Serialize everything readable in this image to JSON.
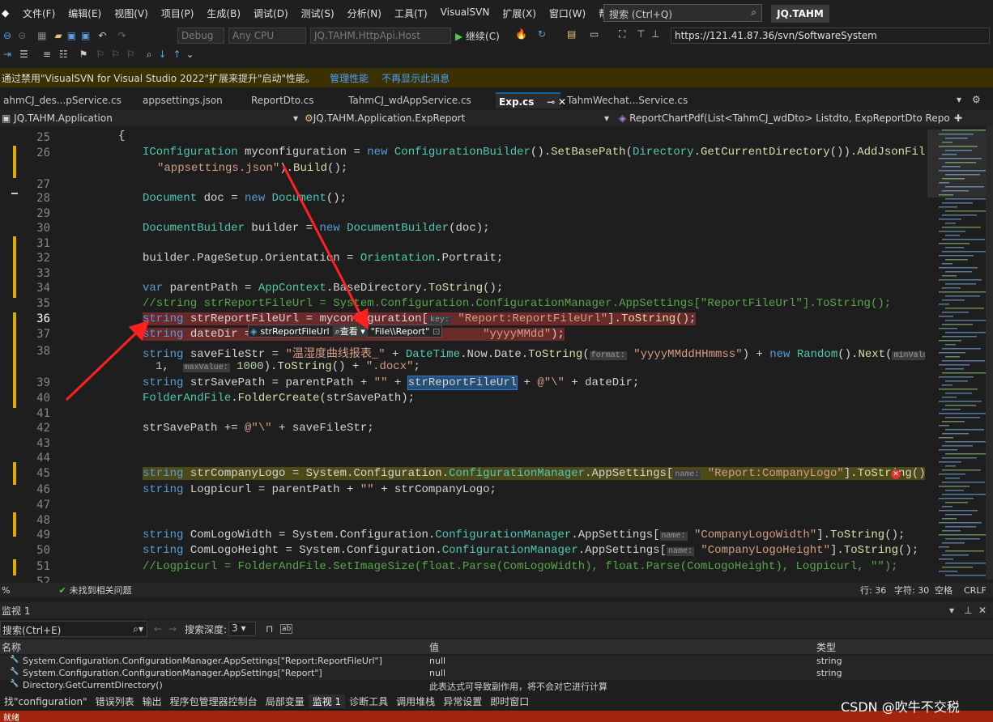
{
  "menu": [
    "文件(F)",
    "编辑(E)",
    "视图(V)",
    "项目(P)",
    "生成(B)",
    "调试(D)",
    "测试(S)",
    "分析(N)",
    "工具(T)",
    "VisualSVN",
    "扩展(X)",
    "窗口(W)",
    "帮助(H)"
  ],
  "search_placeholder": "搜索 (Ctrl+Q)",
  "solution_name": "JQ.TAHM",
  "toolbar": {
    "config": "Debug",
    "platform": "Any CPU",
    "startup_project": "JQ.TAHM.HttpApi.Host",
    "continue_label": "继续(C)",
    "svn_url": "https://121.41.87.36/svn/SoftwareSystem"
  },
  "infobar": {
    "message": "通过禁用\"VisualSVN for Visual Studio 2022\"扩展来提升\"启动\"性能。",
    "link1": "管理性能",
    "link2": "不再显示此消息"
  },
  "tabs": [
    "ahmCJ_des...pService.cs",
    "appsettings.json",
    "ReportDto.cs",
    "TahmCJ_wdAppService.cs",
    "Exp.cs",
    "TahmWechat...Service.cs"
  ],
  "active_tab": "Exp.cs",
  "navbar": {
    "project": "JQ.TAHM.Application",
    "class": "JQ.TAHM.Application.ExpReport",
    "member": "ReportChartPdf(List<TahmCJ_wdDto> Listdto, ExpReportDto Repo"
  },
  "datatip": {
    "name": "strReportFileUrl",
    "action": "查看",
    "value": "\"File\\\\Report\""
  },
  "status_line": {
    "zoom": "%",
    "issues": "未找到相关问题",
    "line": "行: 36",
    "col": "字符: 30",
    "spaces": "空格",
    "eol": "CRLF"
  },
  "watch": {
    "title": "监视 1",
    "search_placeholder": "搜索(Ctrl+E)",
    "depth_label": "搜索深度:",
    "depth_value": "3",
    "columns": [
      "名称",
      "值",
      "类型"
    ],
    "rows": [
      {
        "name": "System.Configuration.ConfigurationManager.AppSettings[\"Report:ReportFileUrl\"]",
        "value": "null",
        "type": "string"
      },
      {
        "name": "System.Configuration.ConfigurationManager.AppSettings[\"Report\"]",
        "value": "null",
        "type": "string"
      },
      {
        "name": "Directory.GetCurrentDirectory()",
        "value": "此表达式可导致副作用，将不会对它进行计算",
        "type": ""
      }
    ]
  },
  "bottom_tabs": [
    "找\"configuration\"",
    "错误列表",
    "输出",
    "程序包管理器控制台",
    "局部变量",
    "监视 1",
    "诊断工具",
    "调用堆栈",
    "异常设置",
    "即时窗口"
  ],
  "statusbar_text": "就绪",
  "watermark": "CSDN @吹牛不交税",
  "lines": [
    "25",
    "26",
    "",
    "27",
    "28",
    "29",
    "30",
    "31",
    "32",
    "33",
    "34",
    "35",
    "36",
    "37",
    "38",
    "",
    "39",
    "40",
    "41",
    "42",
    "43",
    "44",
    "45",
    "46",
    "47",
    "48",
    "49",
    "50",
    "51",
    "52"
  ],
  "accent_colors": {
    "breakpoint_line": "#6a2a2a",
    "yellow_highlight": "#4d4a1a",
    "arrow": "#ff2020"
  }
}
